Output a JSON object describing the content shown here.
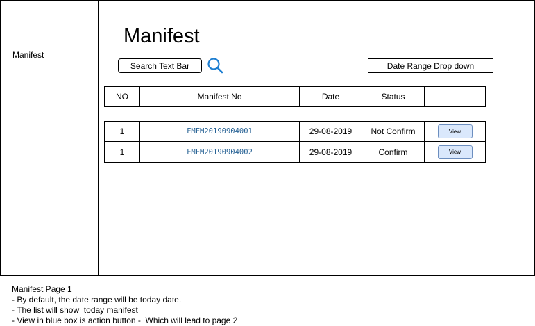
{
  "sidebar": {
    "items": [
      {
        "label": "Manifest"
      }
    ]
  },
  "page": {
    "title": "Manifest"
  },
  "toolbar": {
    "search_placeholder": "Search Text Bar",
    "search_icon": "search-icon",
    "date_range_label": "Date Range Drop down"
  },
  "table": {
    "columns": [
      "NO",
      "Manifest No",
      "Date",
      "Status",
      ""
    ],
    "rows": [
      {
        "no": "1",
        "manifest_no": "FMFM20190904001",
        "date": "29-08-2019",
        "status": "Not Confirm",
        "action": "View"
      },
      {
        "no": "1",
        "manifest_no": "FMFM20190904002",
        "date": "29-08-2019",
        "status": "Confirm",
        "action": "View"
      }
    ]
  },
  "notes": {
    "lines": [
      "Manifest Page 1",
      "- By default, the date range will be today date.",
      "- The list will show  today manifest",
      "- View in blue box is action button -  Which will lead to page 2"
    ]
  },
  "colors": {
    "view_button_fill": "#dae8fc",
    "view_button_border": "#6c8ebf",
    "search_icon": "#1f7fd1",
    "manifest_no_text": "#2a6496"
  }
}
